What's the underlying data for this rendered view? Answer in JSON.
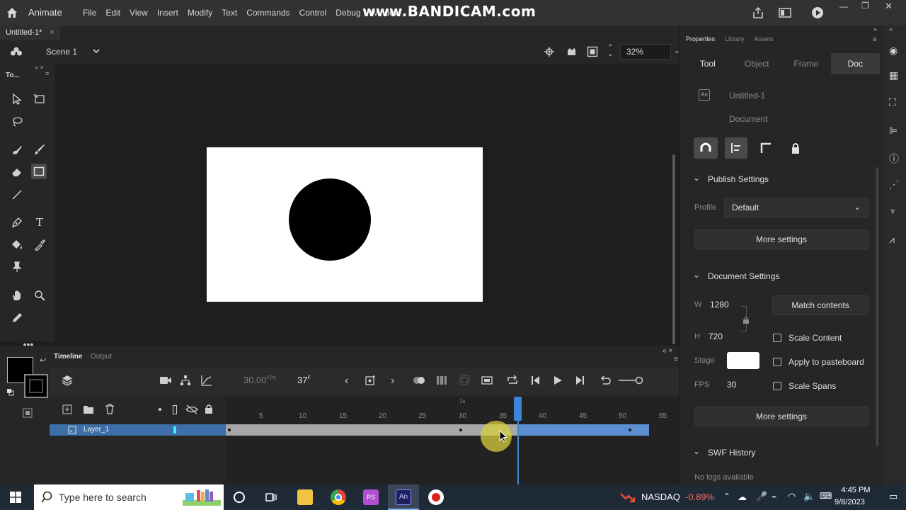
{
  "app": {
    "name": "Animate",
    "menus": [
      "File",
      "Edit",
      "View",
      "Insert",
      "Modify",
      "Text",
      "Commands",
      "Control",
      "Debug",
      "Window"
    ]
  },
  "watermark": "www.BANDICAM.com",
  "document_tab": {
    "label": "Untitled-1*"
  },
  "scene": {
    "label": "Scene 1",
    "zoom": "32%"
  },
  "tools": {
    "title": "To..."
  },
  "timeline": {
    "tab_timeline": "Timeline",
    "tab_output": "Output",
    "fps_value": "30.00",
    "fps_unit": "FPS",
    "current_frame": "37",
    "frame_unit": "F",
    "ruler_marker": "1s",
    "ruler": [
      "5",
      "10",
      "15",
      "20",
      "25",
      "30",
      "35",
      "40",
      "45",
      "50",
      "55"
    ],
    "layers": [
      {
        "name": "Layer_1"
      }
    ]
  },
  "properties": {
    "tabs": [
      "Properties",
      "Library",
      "Assets"
    ],
    "subtabs": [
      "Tool",
      "Object",
      "Frame",
      "Doc"
    ],
    "active_subtab": "Doc",
    "document_name": "Untitled-1",
    "document_type": "Document",
    "publish_settings": {
      "title": "Publish Settings",
      "profile_label": "Profile",
      "profile_value": "Default",
      "more_button": "More settings"
    },
    "document_settings": {
      "title": "Document Settings",
      "w_label": "W",
      "w_value": "1280",
      "h_label": "H",
      "h_value": "720",
      "match_button": "Match contents",
      "scale_content": "Scale Content",
      "stage_label": "Stage",
      "stage_color": "#ffffff",
      "apply_pasteboard": "Apply to pasteboard",
      "fps_label": "FPS",
      "fps_value": "30",
      "scale_spans": "Scale Spans",
      "more_button": "More settings"
    },
    "swf_history": {
      "title": "SWF History",
      "empty": "No logs available"
    }
  },
  "taskbar": {
    "search_placeholder": "Type here to search",
    "ticker": "NASDAQ",
    "ticker_change": "-0.89%",
    "time": "4:45 PM",
    "date": "9/8/2023"
  }
}
